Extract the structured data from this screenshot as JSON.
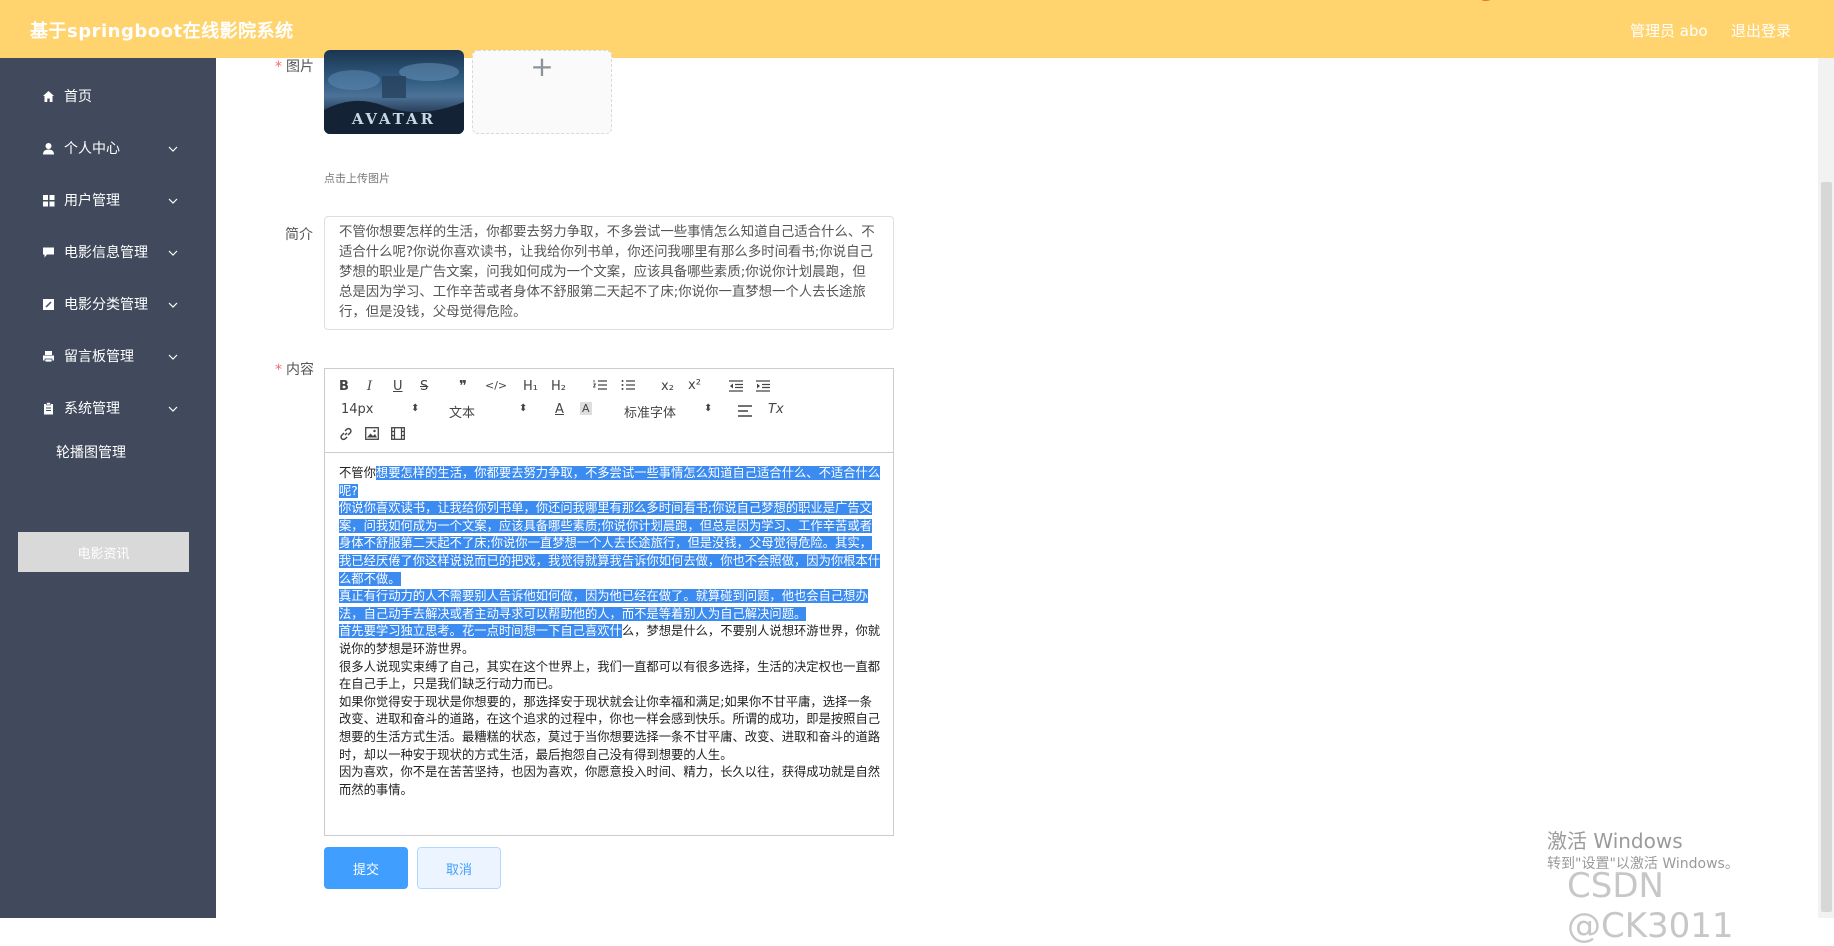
{
  "header": {
    "title": "基于springboot在线影院系统",
    "user": "管理员 abo",
    "logout": "退出登录"
  },
  "sidebar": {
    "items": [
      {
        "label": "首页",
        "icon": "home-icon"
      },
      {
        "label": "个人中心",
        "icon": "user-icon"
      },
      {
        "label": "用户管理",
        "icon": "grid-icon"
      },
      {
        "label": "电影信息管理",
        "icon": "comment-icon"
      },
      {
        "label": "电影分类管理",
        "icon": "edit-icon"
      },
      {
        "label": "留言板管理",
        "icon": "printer-icon"
      },
      {
        "label": "系统管理",
        "icon": "clipboard-icon"
      }
    ],
    "sub_items": [
      {
        "label": "轮播图管理"
      },
      {
        "label": "电影资讯"
      }
    ]
  },
  "form": {
    "image_label": "图片",
    "image_caption": "AVATAR",
    "upload_plus": "+",
    "upload_tip": "点击上传图片",
    "intro_label": "简介",
    "intro_text": "不管你想要怎样的生活，你都要去努力争取，不多尝试一些事情怎么知道自己适合什么、不适合什么呢?你说你喜欢读书，让我给你列书单，你还问我哪里有那么多时间看书;你说自己梦想的职业是广告文案，问我如何成为一个文案，应该具备哪些素质;你说你计划晨跑，但总是因为学习、工作辛苦或者身体不舒服第二天起不了床;你说你一直梦想一个人去长途旅行，但是没钱，父母觉得危险。",
    "content_label": "内容",
    "submit": "提交",
    "cancel": "取消"
  },
  "editor": {
    "toolbar": {
      "bold": "B",
      "italic": "I",
      "underline": "U",
      "strike": "S",
      "quote": "❞",
      "code": "</>",
      "h1": "H₁",
      "h2": "H₂",
      "subscript": "x₂",
      "superscript": "x²",
      "size_value": "14px",
      "header_value": "文本",
      "font_value": "标准字体",
      "color_a": "A",
      "bg_a": "A",
      "clear": "Tx"
    },
    "content": {
      "p1_plain": "不管你",
      "p1_sel": "想要怎样的生活，你都要去努力争取，不多尝试一些事情怎么知道自己适合什么、不适合什么呢?",
      "p2": "你说你喜欢读书，让我给你列书单，你还问我哪里有那么多时间看书;你说自己梦想的职业是广告文案，问我如何成为一个文案，应该具备哪些素质;你说你计划晨跑，但总是因为学习、工作辛苦或者身体不舒服第二天起不了床;你说你一直梦想一个人去长途旅行，但是没钱，父母觉得危险。其实，我已经厌倦了你这样说说而已的把戏，我觉得就算我告诉你如何去做，你也不会照做，因为你根本什么都不做。",
      "p3": "真正有行动力的人不需要别人告诉他如何做，因为他已经在做了。就算碰到问题，他也会自己想办法，自己动手去解决或者主动寻求可以帮助他的人，而不是等着别人为自己解决问题。",
      "p4_sel": "首先要学习独立思考。花一点时间想一下自己喜欢什",
      "p4_plain": "么，梦想是什么，不要别人说想环游世界，你就说你的梦想是环游世界。",
      "p5": "很多人说现实束缚了自己，其实在这个世界上，我们一直都可以有很多选择，生活的决定权也一直都在自己手上，只是我们缺乏行动力而已。",
      "p6": "如果你觉得安于现状是你想要的，那选择安于现状就会让你幸福和满足;如果你不甘平庸，选择一条改变、进取和奋斗的道路，在这个追求的过程中，你也一样会感到快乐。所谓的成功，即是按照自己想要的生活方式生活。最糟糕的状态，莫过于当你想要选择一条不甘平庸、改变、进取和奋斗的道路时，却以一种安于现状的方式生活，最后抱怨自己没有得到想要的人生。",
      "p7": "因为喜欢，你不是在苦苦坚持，也因为喜欢，你愿意投入时间、精力，长久以往，获得成功就是自然而然的事情。"
    }
  },
  "watermark": {
    "activate_line1": "激活 Windows",
    "activate_line2": "转到\"设置\"以激活 Windows。",
    "csdn": "CSDN @CK3011"
  }
}
